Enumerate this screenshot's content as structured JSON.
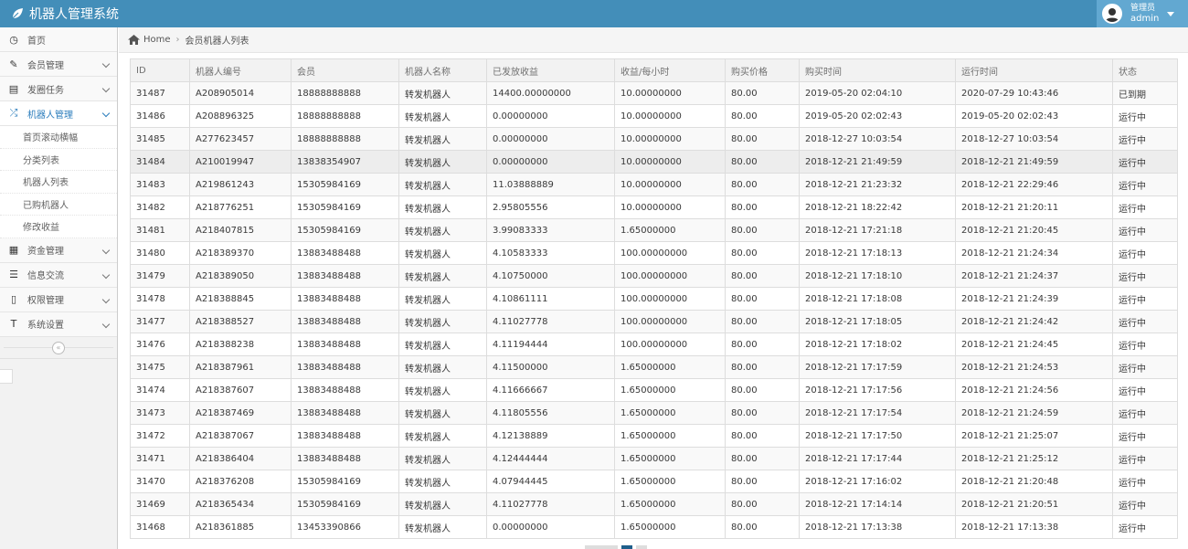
{
  "app": {
    "title": "机器人管理系统"
  },
  "user": {
    "role": "管理员",
    "name": "admin"
  },
  "breadcrumb": {
    "home": "Home",
    "current": "会员机器人列表"
  },
  "sidebar": {
    "items": [
      {
        "label": "首页",
        "icon": "dashboard-icon",
        "glyph": "◷"
      },
      {
        "label": "会员管理",
        "icon": "edit-icon",
        "glyph": "✎"
      },
      {
        "label": "发圈任务",
        "icon": "book-icon",
        "glyph": "▤"
      },
      {
        "label": "机器人管理",
        "icon": "shuffle-icon",
        "glyph": "⤮"
      },
      {
        "label": "资金管理",
        "icon": "calendar-icon",
        "glyph": "▦"
      },
      {
        "label": "信息交流",
        "icon": "list-icon",
        "glyph": "☰"
      },
      {
        "label": "权限管理",
        "icon": "file-icon",
        "glyph": "▯"
      },
      {
        "label": "系统设置",
        "icon": "text-icon",
        "glyph": "T"
      }
    ],
    "subitems": [
      "首页滚动横幅",
      "分类列表",
      "机器人列表",
      "已购机器人",
      "修改收益"
    ]
  },
  "table": {
    "headers": [
      "ID",
      "机器人编号",
      "会员",
      "机器人名称",
      "已发放收益",
      "收益/每小时",
      "购买价格",
      "购买时间",
      "运行时间",
      "状态"
    ],
    "rows": [
      [
        "31487",
        "A208905014",
        "18888888888",
        "转发机器人",
        "14400.00000000",
        "10.00000000",
        "80.00",
        "2019-05-20 02:04:10",
        "2020-07-29 10:43:46",
        "已到期"
      ],
      [
        "31486",
        "A208896325",
        "18888888888",
        "转发机器人",
        "0.00000000",
        "10.00000000",
        "80.00",
        "2019-05-20 02:02:43",
        "2019-05-20 02:02:43",
        "运行中"
      ],
      [
        "31485",
        "A277623457",
        "18888888888",
        "转发机器人",
        "0.00000000",
        "10.00000000",
        "80.00",
        "2018-12-27 10:03:54",
        "2018-12-27 10:03:54",
        "运行中"
      ],
      [
        "31484",
        "A210019947",
        "13838354907",
        "转发机器人",
        "0.00000000",
        "10.00000000",
        "80.00",
        "2018-12-21 21:49:59",
        "2018-12-21 21:49:59",
        "运行中"
      ],
      [
        "31483",
        "A219861243",
        "15305984169",
        "转发机器人",
        "11.03888889",
        "10.00000000",
        "80.00",
        "2018-12-21 21:23:32",
        "2018-12-21 22:29:46",
        "运行中"
      ],
      [
        "31482",
        "A218776251",
        "15305984169",
        "转发机器人",
        "2.95805556",
        "10.00000000",
        "80.00",
        "2018-12-21 18:22:42",
        "2018-12-21 21:20:11",
        "运行中"
      ],
      [
        "31481",
        "A218407815",
        "15305984169",
        "转发机器人",
        "3.99083333",
        "1.65000000",
        "80.00",
        "2018-12-21 17:21:18",
        "2018-12-21 21:20:45",
        "运行中"
      ],
      [
        "31480",
        "A218389370",
        "13883488488",
        "转发机器人",
        "4.10583333",
        "100.00000000",
        "80.00",
        "2018-12-21 17:18:13",
        "2018-12-21 21:24:34",
        "运行中"
      ],
      [
        "31479",
        "A218389050",
        "13883488488",
        "转发机器人",
        "4.10750000",
        "100.00000000",
        "80.00",
        "2018-12-21 17:18:10",
        "2018-12-21 21:24:37",
        "运行中"
      ],
      [
        "31478",
        "A218388845",
        "13883488488",
        "转发机器人",
        "4.10861111",
        "100.00000000",
        "80.00",
        "2018-12-21 17:18:08",
        "2018-12-21 21:24:39",
        "运行中"
      ],
      [
        "31477",
        "A218388527",
        "13883488488",
        "转发机器人",
        "4.11027778",
        "100.00000000",
        "80.00",
        "2018-12-21 17:18:05",
        "2018-12-21 21:24:42",
        "运行中"
      ],
      [
        "31476",
        "A218388238",
        "13883488488",
        "转发机器人",
        "4.11194444",
        "100.00000000",
        "80.00",
        "2018-12-21 17:18:02",
        "2018-12-21 21:24:45",
        "运行中"
      ],
      [
        "31475",
        "A218387961",
        "13883488488",
        "转发机器人",
        "4.11500000",
        "1.65000000",
        "80.00",
        "2018-12-21 17:17:59",
        "2018-12-21 21:24:53",
        "运行中"
      ],
      [
        "31474",
        "A218387607",
        "13883488488",
        "转发机器人",
        "4.11666667",
        "1.65000000",
        "80.00",
        "2018-12-21 17:17:56",
        "2018-12-21 21:24:56",
        "运行中"
      ],
      [
        "31473",
        "A218387469",
        "13883488488",
        "转发机器人",
        "4.11805556",
        "1.65000000",
        "80.00",
        "2018-12-21 17:17:54",
        "2018-12-21 21:24:59",
        "运行中"
      ],
      [
        "31472",
        "A218387067",
        "13883488488",
        "转发机器人",
        "4.12138889",
        "1.65000000",
        "80.00",
        "2018-12-21 17:17:50",
        "2018-12-21 21:25:07",
        "运行中"
      ],
      [
        "31471",
        "A218386404",
        "13883488488",
        "转发机器人",
        "4.12444444",
        "1.65000000",
        "80.00",
        "2018-12-21 17:17:44",
        "2018-12-21 21:25:12",
        "运行中"
      ],
      [
        "31470",
        "A218376208",
        "15305984169",
        "转发机器人",
        "4.07944445",
        "1.65000000",
        "80.00",
        "2018-12-21 17:16:02",
        "2018-12-21 21:20:48",
        "运行中"
      ],
      [
        "31469",
        "A218365434",
        "15305984169",
        "转发机器人",
        "4.11027778",
        "1.65000000",
        "80.00",
        "2018-12-21 17:14:14",
        "2018-12-21 21:20:51",
        "运行中"
      ],
      [
        "31468",
        "A218361885",
        "13453390866",
        "转发机器人",
        "0.00000000",
        "1.65000000",
        "80.00",
        "2018-12-21 17:13:38",
        "2018-12-21 17:13:38",
        "运行中"
      ]
    ]
  },
  "colors": {
    "navbar": "#438eb9",
    "active": "#2b7dbc"
  }
}
